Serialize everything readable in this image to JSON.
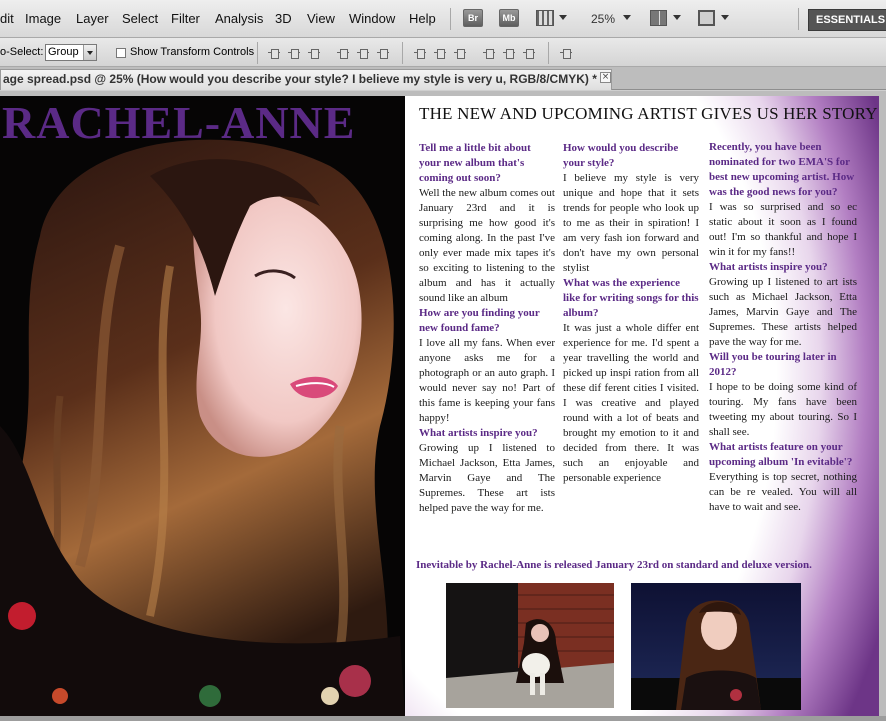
{
  "menu": {
    "items": [
      "dit",
      "Image",
      "Layer",
      "Select",
      "Filter",
      "Analysis",
      "3D",
      "View",
      "Window",
      "Help"
    ],
    "bridge_btn": "Br",
    "minibridge_btn": "Mb",
    "zoom": "25%",
    "workspace": "ESSENTIALS"
  },
  "options": {
    "auto_select_label": "o-Select:",
    "auto_select_value": "Group",
    "show_transform_label": "Show Transform Controls"
  },
  "document": {
    "tab_title": "age spread.psd @ 25% (How would you describe your style? I believe my style is very u, RGB/8/CMYK) *",
    "close": "×"
  },
  "spread": {
    "masthead": "RACHEL-ANNE",
    "headline": "THE NEW AND UPCOMING ARTIST GIVES US HER STORY",
    "col1": [
      {
        "q": "Tell me a little bit about your new album that's coming out soon?",
        "a": "Well the new album comes out January 23rd and it is surprising me how good it's coming along. In the past I've only ever made mix tapes it's so exciting to listening to the album and has it actually sound like an album"
      },
      {
        "q": "How are you finding your new found fame?",
        "a": "I love all my fans. When ever anyone asks me for a photograph or an auto graph. I would never say no! Part of this fame is keeping your fans happy!"
      },
      {
        "q": "What artists inspire you?",
        "a": "Growing up I listened to Michael Jackson, Etta James, Marvin Gaye and The Supremes. These art ists helped pave the way for me."
      }
    ],
    "col2": [
      {
        "q": "How would you describe your style?",
        "a": "I believe my style is very unique and hope that it sets trends for people who look up to me as their in spiration! I am very fash ion forward and don't have my own personal stylist"
      },
      {
        "q": "What was the experience like for writing songs for this album?",
        "a": "It was just a whole differ ent experience for me. I'd spent a year travelling the world and picked up inspi ration from all these dif ferent cities I visited. I was creative and played round with a lot of beats and brought my emotion to it and decided from there. It was such an enjoyable and personable experience"
      }
    ],
    "col3": [
      {
        "q": "Recently, you have been nominated for two EMA'S for best new upcoming artist. How was the good news for you?",
        "a": "I was so surprised and so ec static about it soon as I found out! I'm so thankful and hope I win it for my fans!!"
      },
      {
        "q": "What artists inspire you?",
        "a": "Growing up I listened to art ists such as Michael Jackson, Etta James, Marvin Gaye and The Supremes. These artists helped pave the way for me."
      },
      {
        "q": "Will you be touring later in 2012?",
        "a": "I hope to be doing some kind of touring. My fans have been tweeting my about touring. So I shall see."
      },
      {
        "q": "What artists feature on your upcoming album 'In evitable'?",
        "a": "Everything is top secret, nothing can be re vealed. You will all have to wait and see."
      }
    ],
    "footer": "Inevitable by Rachel-Anne is released January 23rd on standard and deluxe version."
  },
  "colors": {
    "accent_purple": "#5b2a86",
    "masthead": "#5b2a86"
  }
}
